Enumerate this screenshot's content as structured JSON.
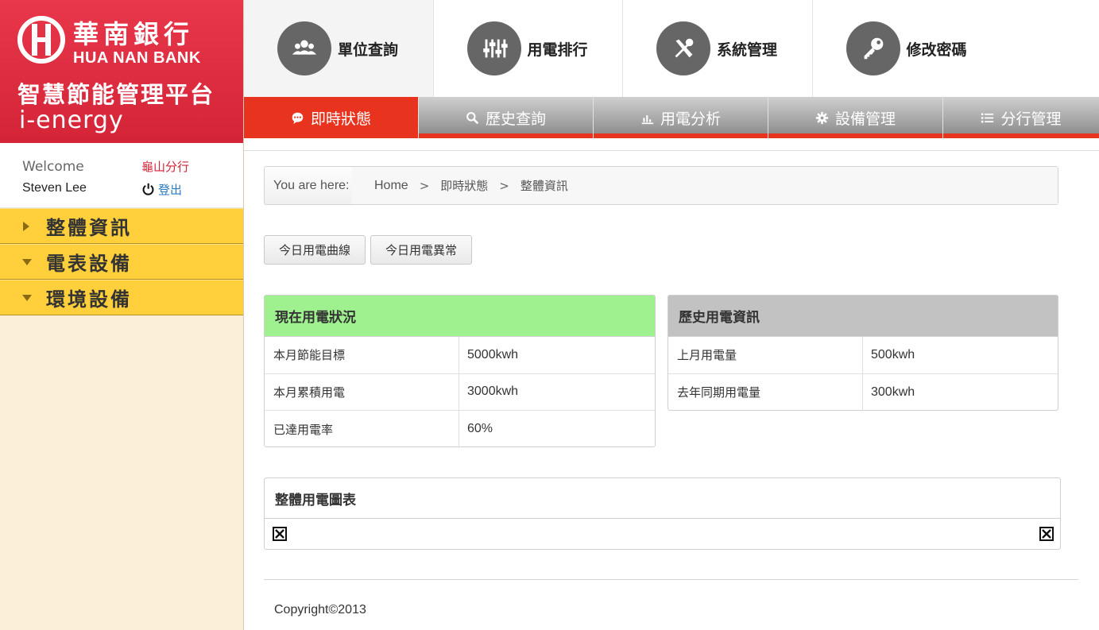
{
  "brand": {
    "name_zh": "華南銀行",
    "name_en": "HUA NAN BANK",
    "platform": "智慧節能管理平台",
    "product": "i-energy",
    "primary_color": "#d42437"
  },
  "user": {
    "welcome": "Welcome",
    "name": "Steven Lee",
    "branch": "龜山分行",
    "logout": "登出"
  },
  "sidebar": {
    "items": [
      {
        "label": "整體資訊",
        "caret": "right"
      },
      {
        "label": "電表設備",
        "caret": "down"
      },
      {
        "label": "環境設備",
        "caret": "down"
      }
    ]
  },
  "topnav": {
    "items": [
      {
        "label": "單位查詢",
        "icon": "group-icon"
      },
      {
        "label": "用電排行",
        "icon": "equalizer-icon"
      },
      {
        "label": "系統管理",
        "icon": "tools-icon"
      },
      {
        "label": "修改密碼",
        "icon": "key-icon"
      }
    ]
  },
  "tabs": {
    "items": [
      {
        "label": "即時狀態",
        "icon": "chat-icon"
      },
      {
        "label": "歷史查詢",
        "icon": "search-icon"
      },
      {
        "label": "用電分析",
        "icon": "bar-chart-icon"
      },
      {
        "label": "設備管理",
        "icon": "gear-icon"
      },
      {
        "label": "分行管理",
        "icon": "list-icon"
      }
    ],
    "active_color": "#e8331f"
  },
  "breadcrumb": {
    "prefix": "You are here:",
    "home": "Home",
    "sep": ">",
    "level1": "即時狀態",
    "level2": "整體資訊"
  },
  "buttons": {
    "curve": "今日用電曲線",
    "anomaly": "今日用電異常"
  },
  "current_panel": {
    "title": "現在用電狀況",
    "header_color": "#9ff08f",
    "rows": [
      {
        "label": "本月節能目標",
        "value": "5000kwh"
      },
      {
        "label": "本月累積用電",
        "value": "3000kwh"
      },
      {
        "label": "已達用電率",
        "value": "60%"
      }
    ]
  },
  "history_panel": {
    "title": "歷史用電資訊",
    "header_color": "#c2c2c2",
    "rows": [
      {
        "label": "上月用電量",
        "value": "500kwh"
      },
      {
        "label": "去年同期用電量",
        "value": "300kwh"
      }
    ]
  },
  "chart_panel": {
    "title": "整體用電圖表"
  },
  "footer": {
    "copyright": "Copyright©2013"
  }
}
